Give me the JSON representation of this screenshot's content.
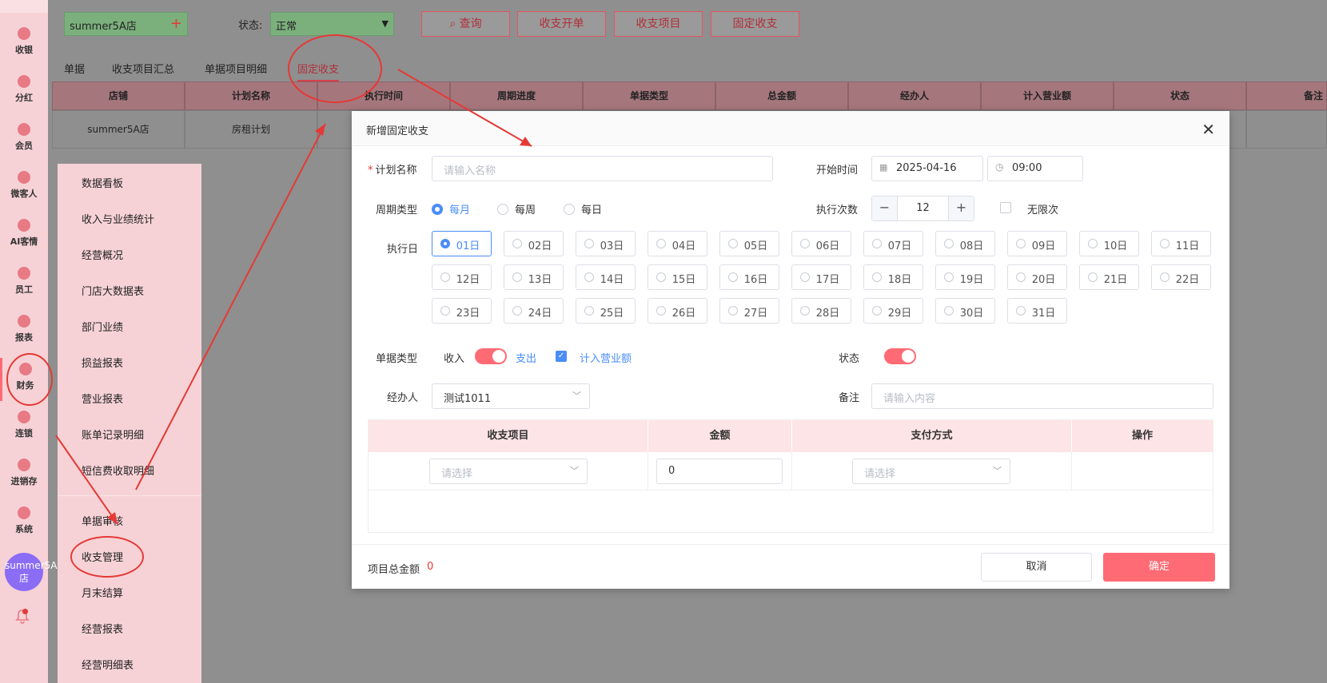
{
  "sidebar": {
    "items": [
      {
        "label": "收银",
        "icon": "cashier-icon"
      },
      {
        "label": "分红",
        "icon": "dividend-icon"
      },
      {
        "label": "会员",
        "icon": "member-icon"
      },
      {
        "label": "微客人",
        "icon": "micro-guest-icon"
      },
      {
        "label": "AI客情",
        "icon": "ai-guest-icon"
      },
      {
        "label": "员工",
        "icon": "staff-icon"
      },
      {
        "label": "报表",
        "icon": "report-icon"
      },
      {
        "label": "财务",
        "icon": "finance-icon"
      },
      {
        "label": "连锁",
        "icon": "chain-icon"
      },
      {
        "label": "进销存",
        "icon": "inventory-icon"
      },
      {
        "label": "系统",
        "icon": "system-icon"
      }
    ],
    "avatar_text": "summer5A店"
  },
  "toolbar": {
    "store": "summer5A店",
    "status_label": "状态:",
    "status_value": "正常",
    "buttons": [
      "查询",
      "收支开单",
      "收支项目",
      "固定收支"
    ]
  },
  "tabs": [
    "单据",
    "收支项目汇总",
    "单据项目明细",
    "固定收支"
  ],
  "bg_table": {
    "headers": [
      "店铺",
      "计划名称",
      "执行时间",
      "周期进度",
      "单据类型",
      "总金额",
      "经办人",
      "计入营业额",
      "状态",
      "备注"
    ],
    "rows": [
      [
        "summer5A店",
        "房租计划",
        "",
        "",
        "",
        "",
        "",
        "",
        "",
        ""
      ]
    ]
  },
  "submenu": {
    "items": [
      "数据看板",
      "收入与业绩统计",
      "经营概况",
      "门店大数据表",
      "部门业绩",
      "损益报表",
      "营业报表",
      "账单记录明细",
      "短信费收取明细"
    ],
    "items2": [
      "单据审核",
      "收支管理",
      "月末结算",
      "经营报表",
      "经营明细表"
    ]
  },
  "modal": {
    "title": "新增固定收支",
    "plan_name_label": "计划名称",
    "plan_name_placeholder": "请输入名称",
    "start_time_label": "开始时间",
    "start_date": "2025-04-16",
    "start_time": "09:00",
    "cycle_label": "周期类型",
    "cycle_options": [
      "每月",
      "每周",
      "每日"
    ],
    "cycle_selected": "每月",
    "exec_count_label": "执行次数",
    "exec_count": "12",
    "unlimited_label": "无限次",
    "exec_day_label": "执行日",
    "days": [
      "01日",
      "02日",
      "03日",
      "04日",
      "05日",
      "06日",
      "07日",
      "08日",
      "09日",
      "10日",
      "11日",
      "12日",
      "13日",
      "14日",
      "15日",
      "16日",
      "17日",
      "18日",
      "19日",
      "20日",
      "21日",
      "22日",
      "23日",
      "24日",
      "25日",
      "26日",
      "27日",
      "28日",
      "29日",
      "30日",
      "31日"
    ],
    "day_selected": "01日",
    "doc_type_label": "单据类型",
    "income_label": "收入",
    "expense_label": "支出",
    "count_revenue_label": "计入营业额",
    "status_label": "状态",
    "handler_label": "经办人",
    "handler_value": "测试1011",
    "remark_label": "备注",
    "remark_placeholder": "请输入内容",
    "items_table": {
      "headers": [
        "收支项目",
        "金额",
        "支付方式",
        "操作"
      ],
      "item_placeholder": "请选择",
      "amount_value": "0",
      "pay_placeholder": "请选择"
    },
    "total_label": "项目总金额",
    "total_value": "0",
    "cancel_label": "取消",
    "ok_label": "确定"
  },
  "colors": {
    "accent": "#ff6b74",
    "selected": "#4a8df8",
    "annotation": "#e53935"
  }
}
